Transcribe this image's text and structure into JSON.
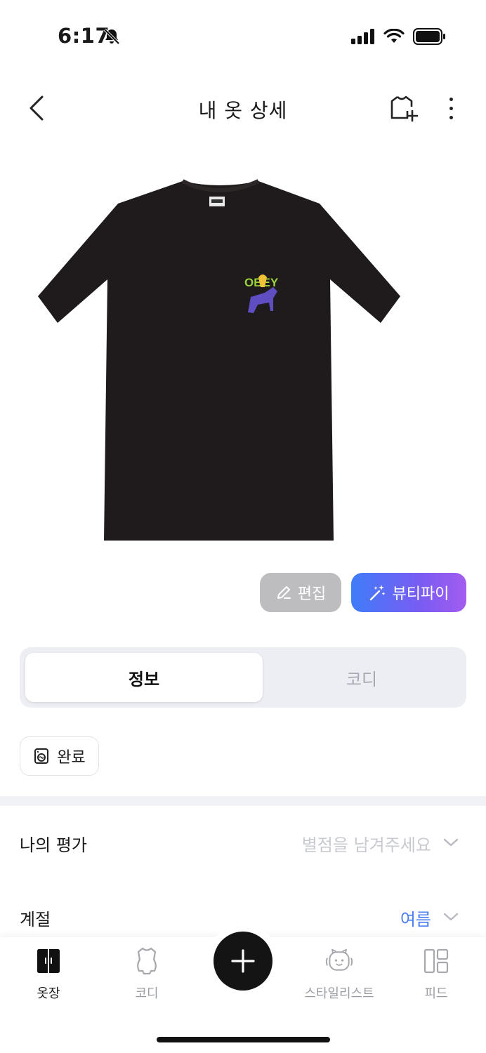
{
  "status_bar": {
    "time": "6:17"
  },
  "nav": {
    "title": "내 옷 상세"
  },
  "actions": {
    "edit_label": "편집",
    "beautify_label": "뷰티파이"
  },
  "segments": {
    "info": "정보",
    "coordi": "코디"
  },
  "wash_chip": {
    "label": "완료"
  },
  "rating": {
    "label": "나의 평가",
    "placeholder": "별점을 남겨주세요"
  },
  "season": {
    "label": "계절",
    "value": "여름"
  },
  "tab_bar": {
    "items": [
      {
        "label": "옷장"
      },
      {
        "label": "코디"
      },
      {
        "label": "스타일리스트"
      },
      {
        "label": "피드"
      }
    ]
  },
  "colors": {
    "accent": "#4a7ef0",
    "gradient_start": "#3f7cf8",
    "gradient_end": "#a35cf0",
    "shirt": "#1f1a1b"
  }
}
